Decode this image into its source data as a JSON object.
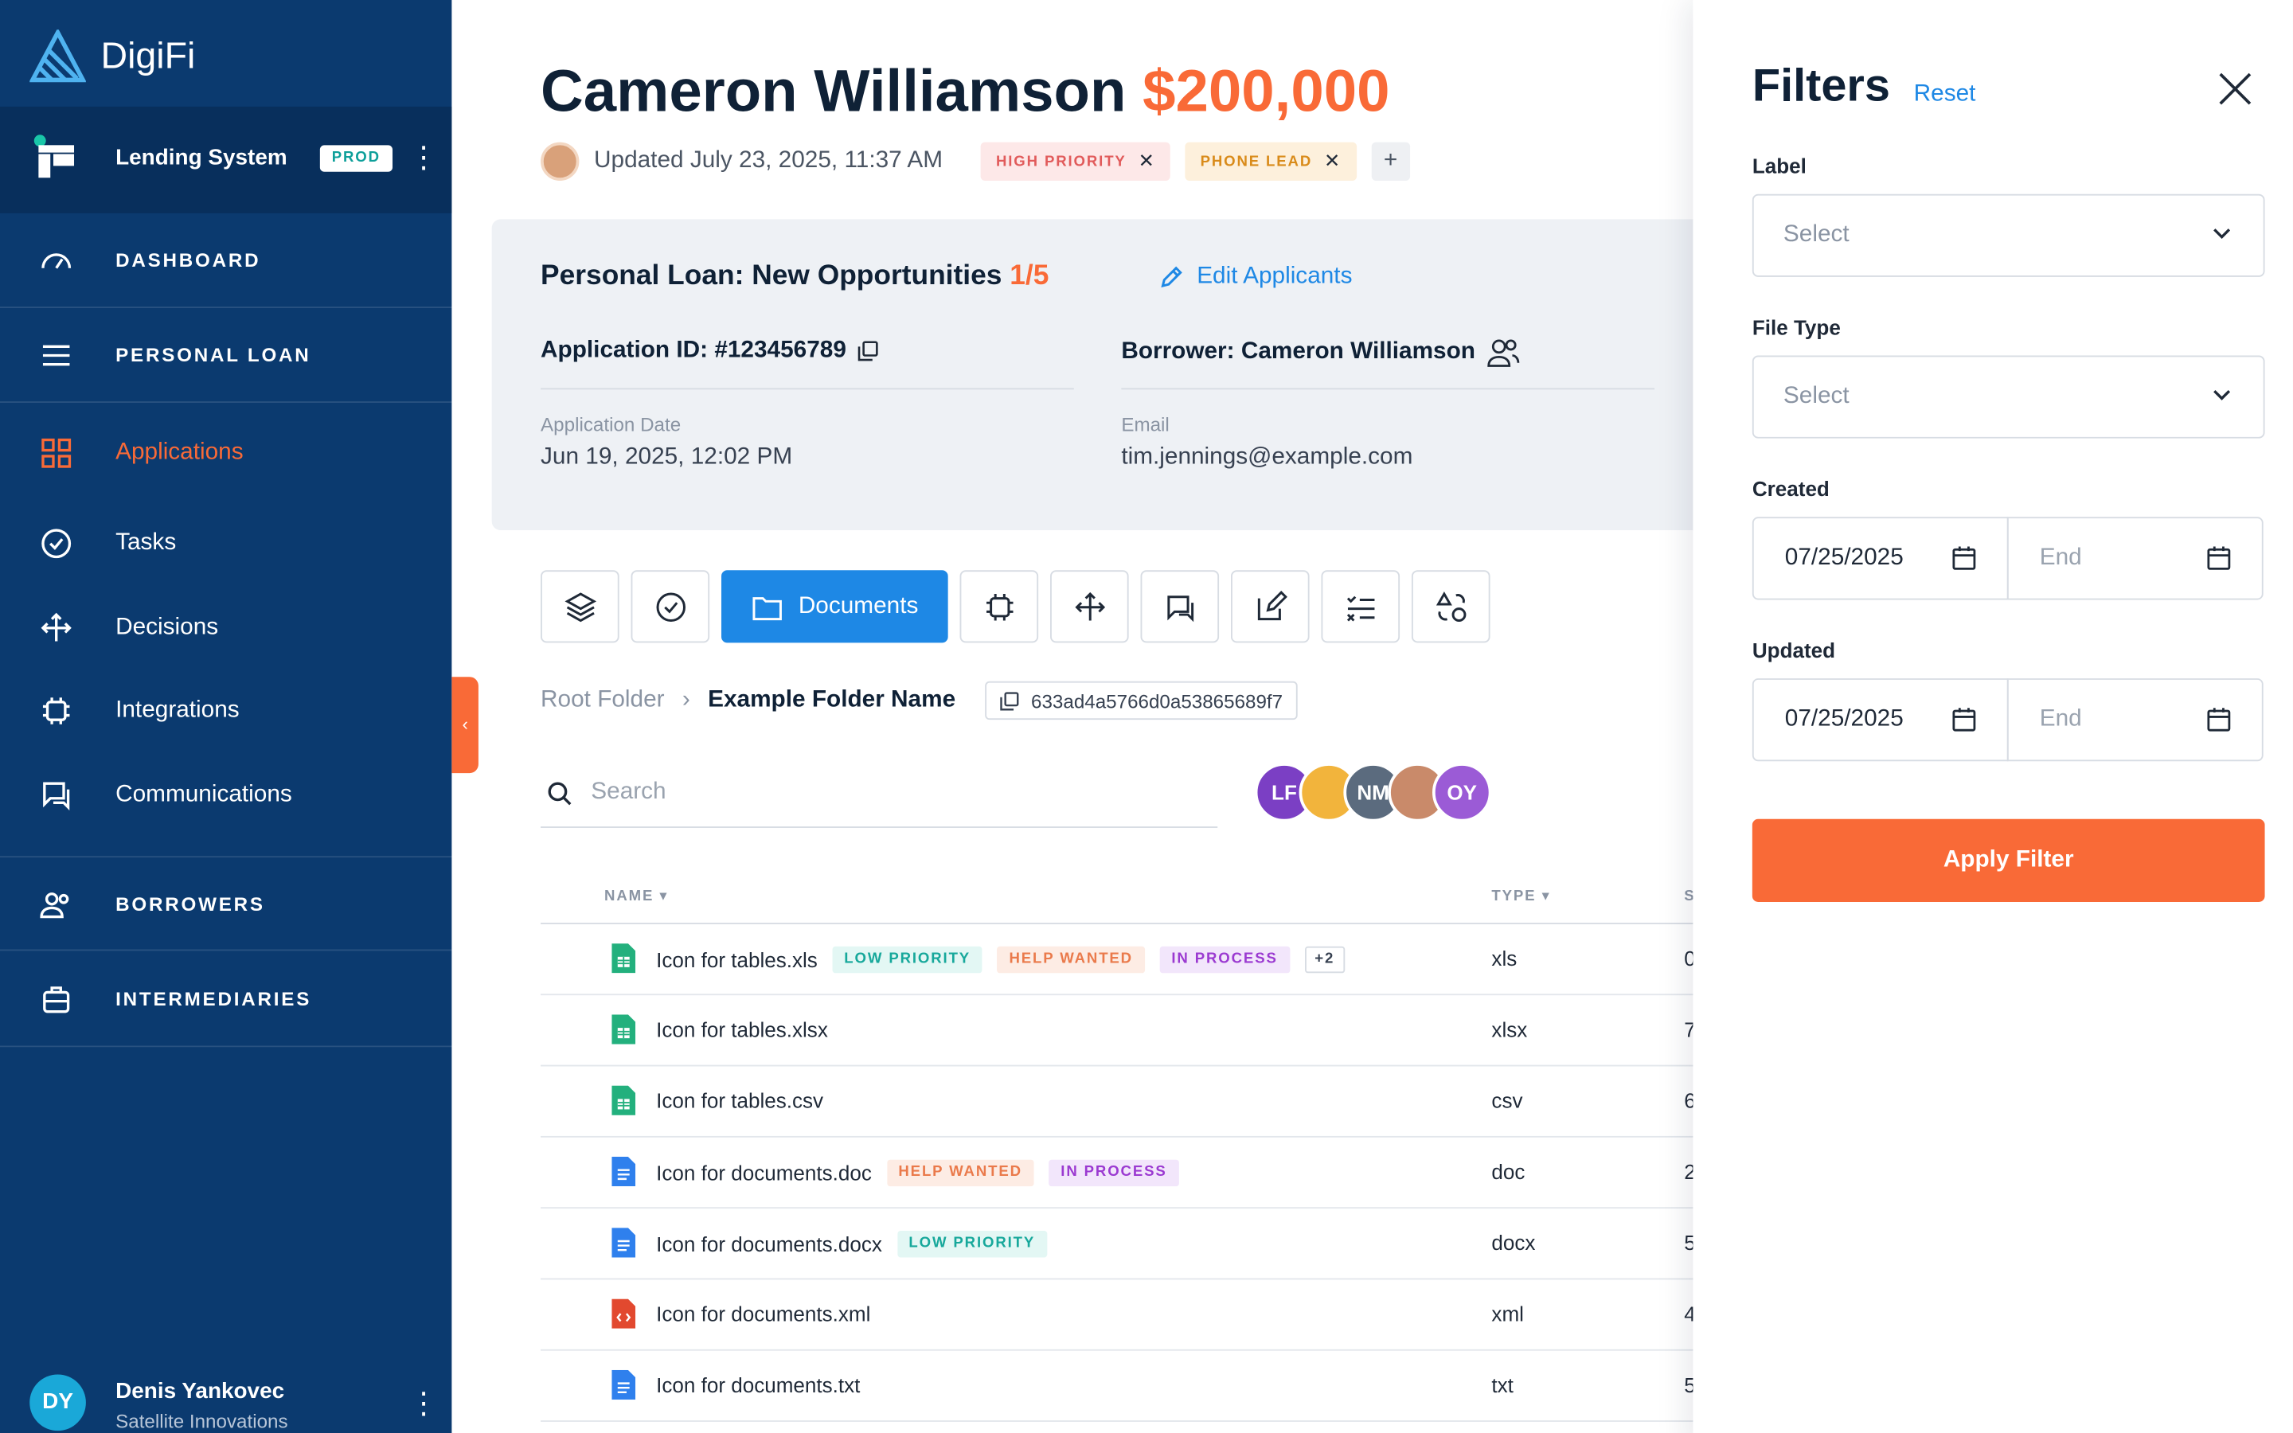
{
  "brand": {
    "name": "DigiFi"
  },
  "system": {
    "name": "Lending System",
    "badge": "PROD"
  },
  "nav": {
    "dashboard": "DASHBOARD",
    "personal_loan": "PERSONAL LOAN",
    "items": [
      {
        "label": "Applications",
        "icon": "applications-icon",
        "active": true
      },
      {
        "label": "Tasks",
        "icon": "tasks-icon"
      },
      {
        "label": "Decisions",
        "icon": "decisions-icon"
      },
      {
        "label": "Integrations",
        "icon": "integrations-icon"
      },
      {
        "label": "Communications",
        "icon": "communications-icon"
      }
    ],
    "borrowers": "BORROWERS",
    "intermediaries": "INTERMEDIARIES"
  },
  "user": {
    "initials": "DY",
    "name": "Denis Yankovec",
    "company": "Satellite Innovations"
  },
  "header": {
    "name": "Cameron Williamson",
    "amount": "$200,000",
    "updated": "Updated July 23, 2025, 11:37 AM",
    "tags": [
      "HIGH PRIORITY",
      "PHONE LEAD"
    ],
    "add_tag": "+"
  },
  "card": {
    "title": "Personal Loan: New Opportunities",
    "fraction": "1/5",
    "edit": "Edit Applicants",
    "application_id": "Application ID: #123456789",
    "borrower": "Borrower: Cameron Williamson",
    "date_label": "Application Date",
    "date_value": "Jun 19, 2025, 12:02 PM",
    "email_label": "Email",
    "email_value": "tim.jennings@example.com"
  },
  "tabs": {
    "active": "Documents"
  },
  "breadcrumb": {
    "root": "Root Folder",
    "sep": "›",
    "current": "Example Folder Name",
    "folder_id": "633ad4a5766d0a53865689f7"
  },
  "search": {
    "placeholder": "Search"
  },
  "collaborators": [
    {
      "initials": "LF",
      "color": "#7b3fc4"
    },
    {
      "initials": "",
      "color": "#f2b43c"
    },
    {
      "initials": "NM",
      "color": "#5b6b7e"
    },
    {
      "initials": "",
      "color": "#c98a6a"
    },
    {
      "initials": "OY",
      "color": "#9b5bd6"
    }
  ],
  "table": {
    "headers": {
      "name": "NAME ▾",
      "type": "TYPE ▾",
      "size": "S"
    },
    "rows": [
      {
        "name": "Icon for tables.xls",
        "type": "xls",
        "size": "0",
        "icon": "sheet",
        "chips": [
          "LOW PRIORITY",
          "HELP WANTED",
          "IN PROCESS",
          "+2"
        ]
      },
      {
        "name": "Icon for tables.xlsx",
        "type": "xlsx",
        "size": "7",
        "icon": "sheet",
        "chips": []
      },
      {
        "name": "Icon for tables.csv",
        "type": "csv",
        "size": "6",
        "icon": "sheet",
        "chips": []
      },
      {
        "name": "Icon for documents.doc",
        "type": "doc",
        "size": "2",
        "icon": "doc",
        "chips": [
          "HELP WANTED",
          "IN PROCESS"
        ]
      },
      {
        "name": "Icon for documents.docx",
        "type": "docx",
        "size": "5",
        "icon": "doc",
        "chips": [
          "LOW PRIORITY"
        ]
      },
      {
        "name": "Icon for documents.xml",
        "type": "xml",
        "size": "4",
        "icon": "xml",
        "chips": []
      },
      {
        "name": "Icon for documents.txt",
        "type": "txt",
        "size": "5",
        "icon": "doc",
        "chips": []
      }
    ]
  },
  "filters": {
    "title": "Filters",
    "reset": "Reset",
    "label_label": "Label",
    "label_placeholder": "Select",
    "filetype_label": "File Type",
    "filetype_placeholder": "Select",
    "created_label": "Created",
    "created_start": "07/25/2025",
    "created_end": "End",
    "updated_label": "Updated",
    "updated_start": "07/25/2025",
    "updated_end": "End",
    "apply": "Apply Filter"
  },
  "colors": {
    "accent": "#f96a37",
    "sidebar": "#0b3a6f",
    "link": "#1e88e5"
  }
}
